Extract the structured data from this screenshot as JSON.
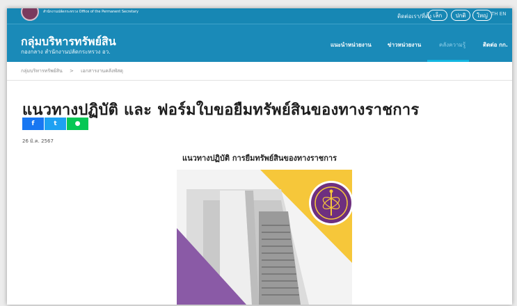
{
  "header": {
    "ministry_label": "สำนักงานปลัดกระทรวง\nOffice of the Permanent Secretary",
    "top_link": "ติดต่อเรา/ที่ตั้ง",
    "font_size_small": "เล็ก",
    "font_size_medium": "ปกติ",
    "font_size_large": "ใหญ่",
    "languages": "TH EN",
    "site_title": "กลุ่มบริหารทรัพย์สิน",
    "site_subtitle": "กองกลาง สำนักงานปลัดกระทรวง อว.",
    "nav": [
      {
        "label": "แนะนำหน่วยงาน"
      },
      {
        "label": "ข่าวหน่วยงาน"
      },
      {
        "label": "คลังความรู้"
      },
      {
        "label": "ติดต่อ กก."
      }
    ]
  },
  "breadcrumb": {
    "items": [
      "กลุ่มบริหารทรัพย์สิน",
      ">",
      "เอกสารงานคลังพัสดุ"
    ]
  },
  "article": {
    "title": "แนวทางปฏิบัติ และ ฟอร์มใบขอยืมทรัพย์สินของทางราชการ",
    "share": {
      "facebook": "f",
      "twitter": "t",
      "line": "●"
    },
    "date": "26 มิ.ค. 2567",
    "subheading": "แนวทางปฏิบัติ การยืมทรัพย์สินของทางราชการ"
  },
  "colors": {
    "header_blue": "#1a8ab8",
    "facebook": "#1877f2",
    "twitter": "#1da1f2",
    "line": "#06c755",
    "poster_yellow": "#f6c73a",
    "poster_purple": "#8a5aa6"
  }
}
